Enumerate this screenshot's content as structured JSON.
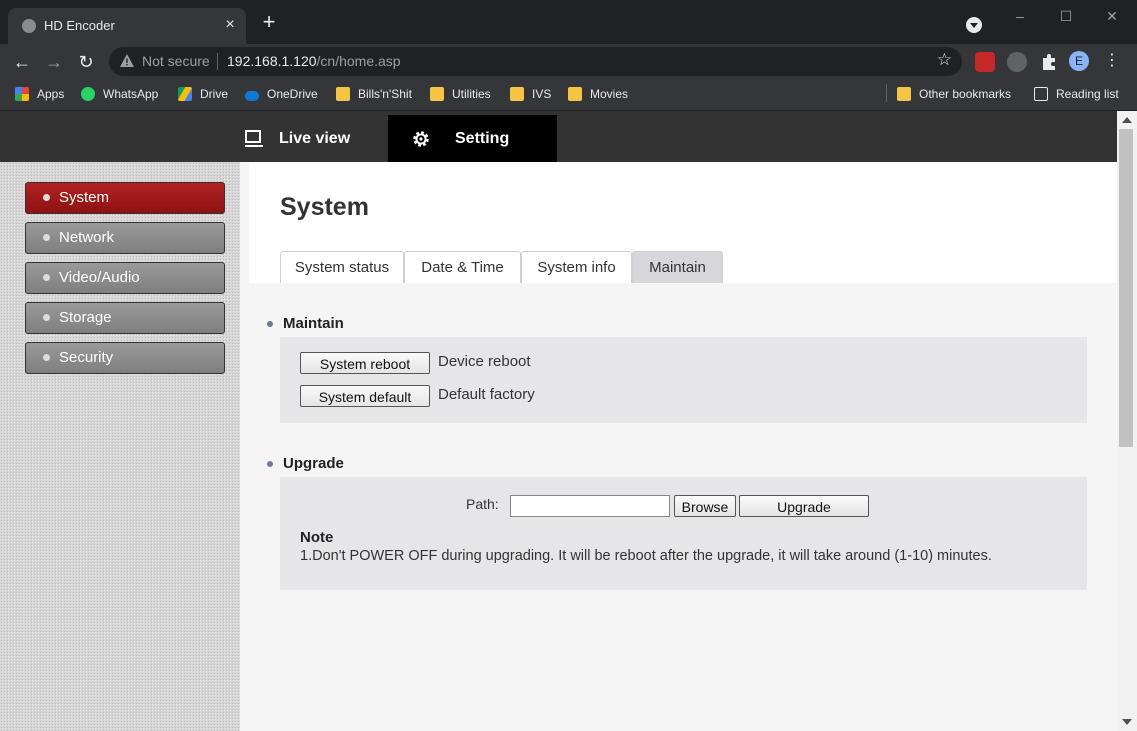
{
  "browser": {
    "tab_title": "HD Encoder",
    "tab_close": "×",
    "new_tab": "+",
    "security_label": "Not secure",
    "url_host": "192.168.1.120",
    "url_path": "/cn/home.asp",
    "avatar_letter": "E",
    "window_controls": [
      "–",
      "☐",
      "✕"
    ],
    "bookmarks": [
      "Apps",
      "WhatsApp",
      "Drive",
      "OneDrive",
      "Bills'n'Shit",
      "Utilities",
      "IVS",
      "Movies"
    ],
    "other_bookmarks": "Other bookmarks",
    "reading_list": "Reading list"
  },
  "app": {
    "nav": {
      "live_view": "Live view",
      "setting": "Setting"
    },
    "sidebar": {
      "items": [
        {
          "label": "System",
          "active": true
        },
        {
          "label": "Network",
          "active": false
        },
        {
          "label": "Video/Audio",
          "active": false
        },
        {
          "label": "Storage",
          "active": false
        },
        {
          "label": "Security",
          "active": false
        }
      ]
    },
    "page_title": "System",
    "tabs": [
      {
        "label": "System status",
        "active": false
      },
      {
        "label": "Date & Time",
        "active": false
      },
      {
        "label": "System info",
        "active": false
      },
      {
        "label": "Maintain",
        "active": true
      }
    ],
    "maintain": {
      "title": "Maintain",
      "reboot_button": "System reboot",
      "reboot_desc": "Device reboot",
      "default_button": "System default",
      "default_desc": "Default factory"
    },
    "upgrade": {
      "title": "Upgrade",
      "path_label": "Path:",
      "path_value": "",
      "browse_button": "Browse",
      "upgrade_button": "Upgrade",
      "note_title": "Note",
      "note_text": "1.Don't POWER OFF during upgrading. It will be reboot after the upgrade, it will take around (1-10) minutes."
    }
  },
  "colors": {
    "active_side_item": "#a01a1a",
    "inactive_side_item": "#8c8c8c",
    "nav_bar": "#333333",
    "nav_active": "#000000"
  }
}
